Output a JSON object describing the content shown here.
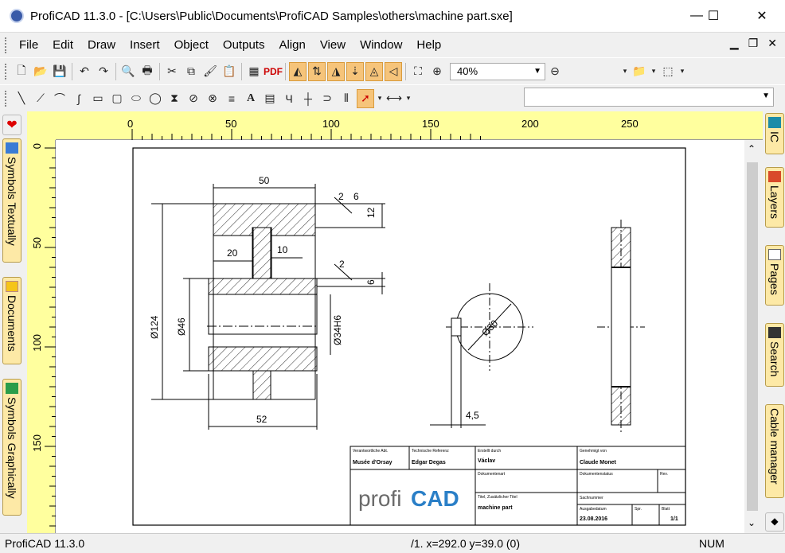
{
  "window": {
    "title": "ProfiCAD 11.3.0 - [C:\\Users\\Public\\Documents\\ProfiCAD Samples\\others\\machine part.sxe]"
  },
  "menu": [
    "File",
    "Edit",
    "Draw",
    "Insert",
    "Object",
    "Outputs",
    "Align",
    "View",
    "Window",
    "Help"
  ],
  "toolbar": {
    "zoom": "40%",
    "pdf": "PDF"
  },
  "left_tabs": [
    "Symbols Textually",
    "Documents",
    "Symbols Graphically"
  ],
  "right_tabs": [
    "IC",
    "Layers",
    "Pages",
    "Search",
    "Cable manager"
  ],
  "ruler": {
    "top": [
      "0",
      "50",
      "100",
      "150",
      "200",
      "250"
    ],
    "left": [
      "0",
      "50",
      "100",
      "150"
    ]
  },
  "drawing": {
    "dims": {
      "d50": "50",
      "d2a": "2",
      "d6a": "6",
      "d12": "12",
      "d20": "20",
      "d10": "10",
      "d2b": "2",
      "d6b": "6",
      "d124": "Ø124",
      "d46": "Ø46",
      "d34": "Ø34H6",
      "d52": "52",
      "d30": "Ø30",
      "d45": "4,5"
    },
    "title_block": {
      "resp_label": "Verantwortliche Abt.",
      "resp_value": "Musée d'Orsay",
      "tech_label": "Technische Referenz",
      "tech_value": "Edgar Degas",
      "created_label": "Erstellt durch",
      "created_value": "Václav",
      "approved_label": "Genehmigt von",
      "approved_value": "Claude Monet",
      "doctype_label": "Dokumentenart",
      "docstatus_label": "Dokumentenstatus",
      "rev_label": "Rev.",
      "title_label": "Titel, Zusätzlicher Titel",
      "title_value": "machine part",
      "sach_label": "Sachnummer",
      "issue_label": "Ausgabedatum",
      "issue_value": "23.08.2016",
      "spr_label": "Spr.",
      "sheet_label": "Blatt",
      "sheet_value": "1/1",
      "logo_left": "profi",
      "logo_right": "CAD"
    }
  },
  "status": {
    "app": "ProfiCAD 11.3.0",
    "coords": "/1.  x=292.0  y=39.0 (0)",
    "num": "NUM"
  }
}
